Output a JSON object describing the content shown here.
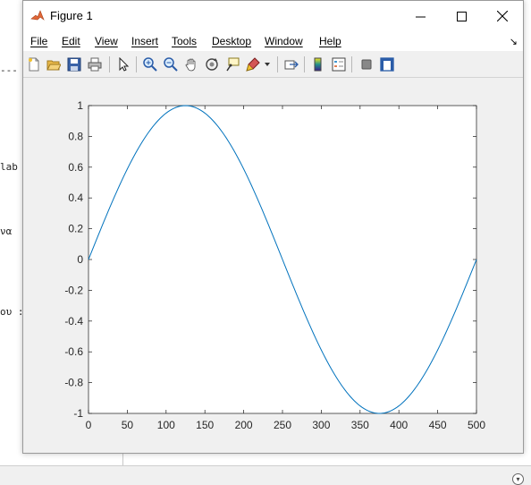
{
  "window": {
    "title": "Figure 1"
  },
  "menu": {
    "items": [
      {
        "label": "File"
      },
      {
        "label": "Edit"
      },
      {
        "label": "View"
      },
      {
        "label": "Insert"
      },
      {
        "label": "Tools"
      },
      {
        "label": "Desktop"
      },
      {
        "label": "Window"
      },
      {
        "label": "Help"
      }
    ]
  },
  "toolbar": {
    "icons": [
      "new-figure-icon",
      "open-file-icon",
      "save-icon",
      "print-icon",
      "edit-plot-icon",
      "zoom-in-icon",
      "zoom-out-icon",
      "pan-icon",
      "rotate-3d-icon",
      "data-cursor-icon",
      "brush-icon",
      "link-plot-icon",
      "colorbar-icon",
      "legend-icon",
      "hide-plot-tools-icon",
      "show-plot-tools-icon"
    ]
  },
  "background": {
    "line1": "---",
    "line2": "lab",
    "line3": "να",
    "line4": "ου :"
  },
  "colors": {
    "line": "#0072bd",
    "axes": "#262626",
    "figure_bg": "#f0f0f0"
  },
  "chart_data": {
    "type": "line",
    "function": "sin(2*pi*x/500)",
    "x_range": [
      0,
      500
    ],
    "x": [
      0,
      25,
      50,
      75,
      100,
      125,
      150,
      175,
      200,
      225,
      250,
      275,
      300,
      325,
      350,
      375,
      400,
      425,
      450,
      475,
      500
    ],
    "y": [
      0,
      0.309,
      0.588,
      0.809,
      0.951,
      1,
      0.951,
      0.809,
      0.588,
      0.309,
      0,
      -0.309,
      -0.588,
      -0.809,
      -0.951,
      -1,
      -0.951,
      -0.809,
      -0.588,
      -0.309,
      0
    ],
    "xlim": [
      0,
      500
    ],
    "ylim": [
      -1,
      1
    ],
    "xticks": [
      "0",
      "50",
      "100",
      "150",
      "200",
      "250",
      "300",
      "350",
      "400",
      "450",
      "500"
    ],
    "yticks": [
      "1",
      "0.8",
      "0.6",
      "0.4",
      "0.2",
      "0",
      "-0.2",
      "-0.4",
      "-0.6",
      "-0.8",
      "-1"
    ],
    "grid": false,
    "title": "",
    "xlabel": "",
    "ylabel": ""
  }
}
